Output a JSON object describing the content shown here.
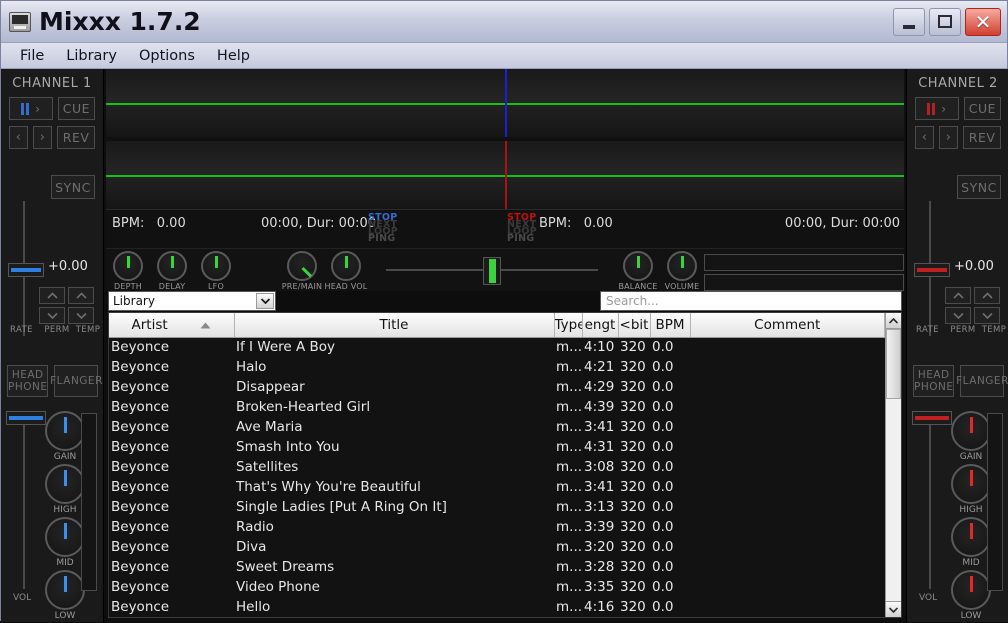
{
  "window": {
    "title": "Mixxx 1.7.2",
    "minimize_label": "Minimize",
    "maximize_label": "Maximize",
    "close_label": "Close"
  },
  "menu": [
    "File",
    "Library",
    "Options",
    "Help"
  ],
  "channel1": {
    "label": "CHANNEL 1",
    "accent": "#2f6fd0",
    "play_label": "",
    "cue_label": "CUE",
    "rev_label": "REV",
    "back_label": "‹",
    "fwd_label": "›",
    "sync_label": "SYNC",
    "rate_value": "+0.00",
    "rate_label": "RATE",
    "perm_label": "PERM",
    "temp_label": "TEMP",
    "headphone_line1": "HEAD",
    "headphone_line2": "PHONE",
    "flanger_label": "FLANGER",
    "vol_label": "VOL",
    "knobs": [
      "GAIN",
      "HIGH",
      "MID",
      "LOW"
    ]
  },
  "channel2": {
    "label": "CHANNEL 2",
    "accent": "#c02020",
    "cue_label": "CUE",
    "rev_label": "REV",
    "sync_label": "SYNC",
    "rate_value": "+0.00",
    "rate_label": "RATE",
    "perm_label": "PERM",
    "temp_label": "TEMP",
    "headphone_line1": "HEAD",
    "headphone_line2": "PHONE",
    "flanger_label": "FLANGER",
    "vol_label": "VOL",
    "knobs": [
      "GAIN",
      "HIGH",
      "MID",
      "LOW"
    ]
  },
  "deck1_status": {
    "bpm_label": "BPM:",
    "bpm_value": "0.00",
    "time_dur": "00:00, Dur: 00:00",
    "modes": [
      "STOP",
      "NEXT",
      "LOOP",
      "PING"
    ]
  },
  "deck2_status": {
    "bpm_label": "BPM:",
    "bpm_value": "0.00",
    "time_dur": "00:00, Dur: 00:00",
    "modes": [
      "STOP",
      "NEXT",
      "LOOP",
      "PING"
    ]
  },
  "effects": {
    "left_knobs": [
      "DEPTH",
      "DELAY",
      "LFO"
    ],
    "pre_main_label": "PRE/MAIN",
    "head_vol_label": "HEAD VOL",
    "right_knobs": [
      "BALANCE",
      "VOLUME"
    ]
  },
  "library": {
    "selector_value": "Library",
    "selector_options": [
      "Library"
    ],
    "search_placeholder": "Search...",
    "columns": [
      "Artist",
      "Title",
      "Type",
      "Length",
      "Bitrate",
      "BPM",
      "Comment"
    ],
    "column_display": [
      "Artist",
      "Title",
      "Type",
      "engt",
      "<bit",
      "BPM",
      "Comment"
    ],
    "sort_column": "Artist",
    "sort_direction": "ascending",
    "rows": [
      {
        "artist": "Beyonce",
        "title": "If I Were A Boy",
        "type": "m...",
        "length": "4:10",
        "bitrate": "320",
        "bpm": "0.0",
        "comment": ""
      },
      {
        "artist": "Beyonce",
        "title": "Halo",
        "type": "m...",
        "length": "4:21",
        "bitrate": "320",
        "bpm": "0.0",
        "comment": ""
      },
      {
        "artist": "Beyonce",
        "title": "Disappear",
        "type": "m...",
        "length": "4:29",
        "bitrate": "320",
        "bpm": "0.0",
        "comment": ""
      },
      {
        "artist": "Beyonce",
        "title": "Broken-Hearted Girl",
        "type": "m...",
        "length": "4:39",
        "bitrate": "320",
        "bpm": "0.0",
        "comment": ""
      },
      {
        "artist": "Beyonce",
        "title": "Ave Maria",
        "type": "m...",
        "length": "3:41",
        "bitrate": "320",
        "bpm": "0.0",
        "comment": ""
      },
      {
        "artist": "Beyonce",
        "title": "Smash Into You",
        "type": "m...",
        "length": "4:31",
        "bitrate": "320",
        "bpm": "0.0",
        "comment": ""
      },
      {
        "artist": "Beyonce",
        "title": "Satellites",
        "type": "m...",
        "length": "3:08",
        "bitrate": "320",
        "bpm": "0.0",
        "comment": ""
      },
      {
        "artist": "Beyonce",
        "title": "That's Why You're Beautiful",
        "type": "m...",
        "length": "3:41",
        "bitrate": "320",
        "bpm": "0.0",
        "comment": ""
      },
      {
        "artist": "Beyonce",
        "title": "Single Ladies [Put A Ring On It]",
        "type": "m...",
        "length": "3:13",
        "bitrate": "320",
        "bpm": "0.0",
        "comment": ""
      },
      {
        "artist": "Beyonce",
        "title": "Radio",
        "type": "m...",
        "length": "3:39",
        "bitrate": "320",
        "bpm": "0.0",
        "comment": ""
      },
      {
        "artist": "Beyonce",
        "title": "Diva",
        "type": "m...",
        "length": "3:20",
        "bitrate": "320",
        "bpm": "0.0",
        "comment": ""
      },
      {
        "artist": "Beyonce",
        "title": "Sweet Dreams",
        "type": "m...",
        "length": "3:28",
        "bitrate": "320",
        "bpm": "0.0",
        "comment": ""
      },
      {
        "artist": "Beyonce",
        "title": "Video Phone",
        "type": "m...",
        "length": "3:35",
        "bitrate": "320",
        "bpm": "0.0",
        "comment": ""
      },
      {
        "artist": "Beyonce",
        "title": "Hello",
        "type": "m...",
        "length": "4:16",
        "bitrate": "320",
        "bpm": "0.0",
        "comment": ""
      }
    ]
  }
}
